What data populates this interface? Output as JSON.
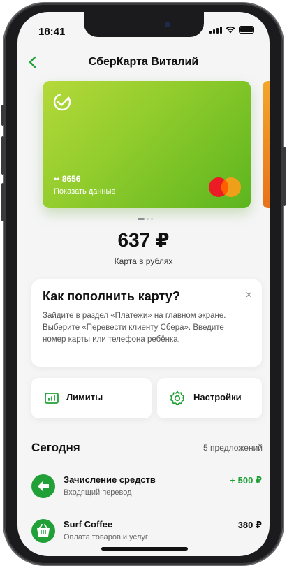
{
  "status_bar": {
    "time": "18:41"
  },
  "header": {
    "title": "СберКарта Виталий"
  },
  "card": {
    "number": "•• 8656",
    "show_data": "Показать данные"
  },
  "balance": {
    "amount": "637 ₽",
    "label": "Карта в рублях"
  },
  "tip": {
    "title": "Как пополнить карту?",
    "close": "×",
    "text": "Зайдите в раздел «Платежи» на главном экране. Выберите «Перевести клиенту Сбера». Введите номер карты или телефона ребёнка."
  },
  "tiles": {
    "limits": "Лимиты",
    "settings": "Настройки"
  },
  "today": {
    "title": "Сегодня",
    "offers": "5 предложений"
  },
  "transactions": [
    {
      "title": "Зачисление средств",
      "subtitle": "Входящий перевод",
      "amount": "+ 500 ₽",
      "icon": "arrow-left-icon"
    },
    {
      "title": "Surf Coffee",
      "subtitle": "Оплата товаров и услуг",
      "amount": "380 ₽",
      "icon": "basket-icon"
    }
  ],
  "colors": {
    "accent": "#21a038",
    "income": "#21a038",
    "card_start": "#b5d93a",
    "card_end": "#5cb51e"
  }
}
